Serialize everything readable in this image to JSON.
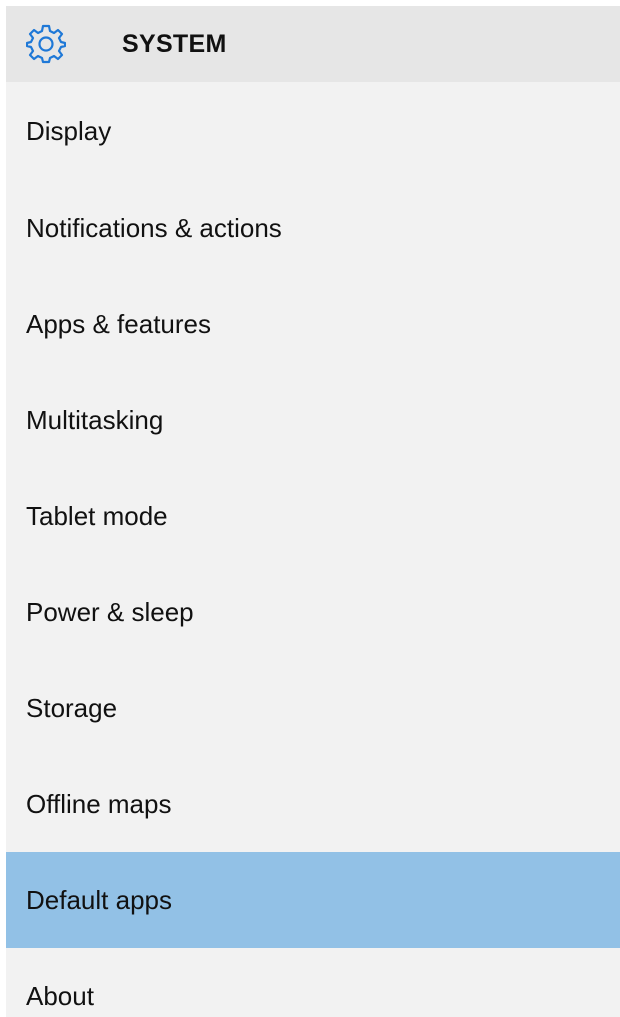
{
  "header": {
    "icon": "gear-icon",
    "title": "SYSTEM",
    "accent_color": "#1e78d7"
  },
  "nav": {
    "selected_index": 8,
    "selected_color": "#92c1e6",
    "items": [
      {
        "label": "Display"
      },
      {
        "label": "Notifications & actions"
      },
      {
        "label": "Apps & features"
      },
      {
        "label": "Multitasking"
      },
      {
        "label": "Tablet mode"
      },
      {
        "label": "Power & sleep"
      },
      {
        "label": "Storage"
      },
      {
        "label": "Offline maps"
      },
      {
        "label": "Default apps"
      },
      {
        "label": "About"
      }
    ]
  }
}
